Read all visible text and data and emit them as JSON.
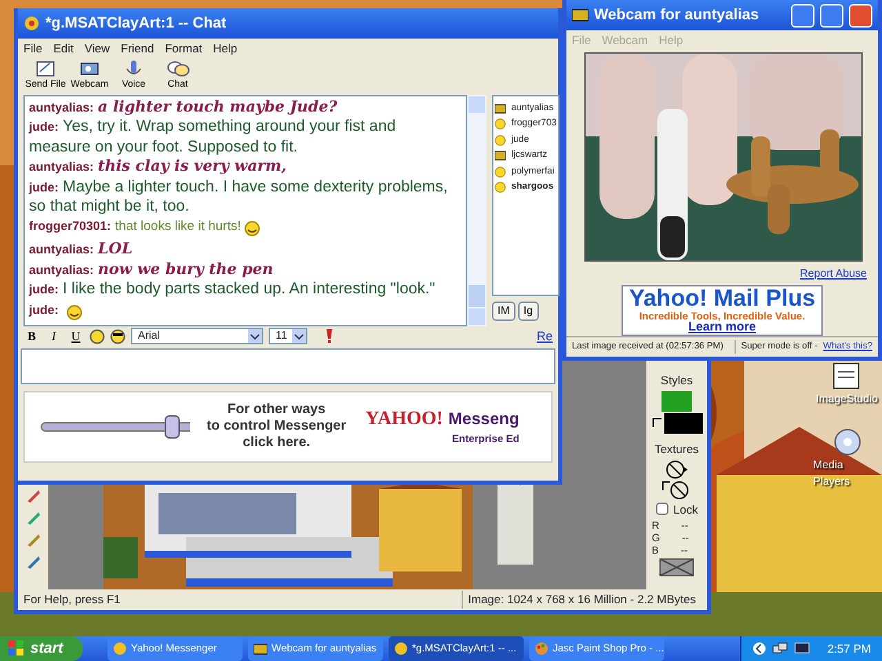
{
  "desktop_icons": [
    {
      "label": "ImageStudio"
    },
    {
      "label": "Media Players"
    }
  ],
  "paint_shop": {
    "styles_label": "Styles",
    "swatches": [
      {
        "color": "#22a022"
      },
      {
        "color": "#000000"
      }
    ],
    "textures_label": "Textures",
    "lock": {
      "label": "Lock",
      "checked": false
    },
    "rgb": [
      {
        "channel": "R",
        "value": "--"
      },
      {
        "channel": "G",
        "value": "--"
      },
      {
        "channel": "B",
        "value": "--"
      }
    ],
    "status_left": "For Help, press F1",
    "status_right": "Image:  1024 x 768 x 16 Million - 2.2 MBytes"
  },
  "chat_window": {
    "title": "*g.MSATClayArt:1 -- Chat",
    "menu": [
      "File",
      "Edit",
      "View",
      "Friend",
      "Format",
      "Help"
    ],
    "toolbar": [
      {
        "label": "Send File",
        "kind": "file"
      },
      {
        "label": "Webcam",
        "kind": "webcam"
      },
      {
        "label": "Voice",
        "kind": "voice"
      },
      {
        "label": "Chat",
        "kind": "chat"
      }
    ],
    "messages": [
      {
        "sender": "auntyalias:",
        "text": "a lighter touch maybe Jude?",
        "kind": "script",
        "color": "#8a1c4e"
      },
      {
        "sender": "jude:",
        "text": "Yes, try it. Wrap something around your fist and measure on your foot. Supposed to fit.",
        "kind": "comic",
        "color": "#1d5a2c"
      },
      {
        "sender": "auntyalias:",
        "text": "this clay is very warm,",
        "kind": "script",
        "color": "#8a1c4e"
      },
      {
        "sender": "jude:",
        "text": "Maybe a lighter touch. I have some dexterity problems, so that might be it, too.",
        "kind": "comic",
        "color": "#1d5a2c"
      },
      {
        "sender": "frogger70301:",
        "text": "that looks like it hurts!",
        "kind": "plain",
        "color": "#5f8a2a",
        "emoticon": true
      },
      {
        "sender": "auntyalias:",
        "text": "LOL",
        "kind": "script",
        "color": "#8a1c4e"
      },
      {
        "sender": "auntyalias:",
        "text": "now we bury the pen",
        "kind": "script",
        "color": "#8a1c4e"
      },
      {
        "sender": "jude:",
        "text": "I like the body parts stacked up. An interesting \"look.\"",
        "kind": "comic",
        "color": "#1d5a2c"
      },
      {
        "sender": "jude:",
        "kind": "comic",
        "emoticon": true
      }
    ],
    "users": [
      {
        "name": "auntyalias",
        "kind": "webcam",
        "bold": false
      },
      {
        "name": "frogger703",
        "kind": "smiley",
        "bold": false
      },
      {
        "name": "jude",
        "kind": "smiley",
        "bold": false
      },
      {
        "name": "ljcswartz",
        "kind": "webcam",
        "bold": false
      },
      {
        "name": "polymerfai",
        "kind": "smiley",
        "bold": false
      },
      {
        "name": "shargoos",
        "kind": "smiley",
        "bold": true
      }
    ],
    "buttons": [
      "IM",
      "Ig"
    ],
    "format_bar": {
      "bold": "B",
      "italic": "I",
      "underline": "U",
      "font": "Arial",
      "size": "11"
    },
    "link": "Re",
    "ad": {
      "lines": [
        "For other ways",
        "to control Messenger",
        "click here."
      ],
      "brand": "YAHOO!",
      "product": "Messeng",
      "edition": "Enterprise Ed"
    }
  },
  "webcam_window": {
    "title": "Webcam for auntyalias",
    "menu": [
      {
        "label": "File",
        "disabled": true
      },
      {
        "label": "Webcam",
        "disabled": true
      },
      {
        "label": "Help",
        "disabled": true
      }
    ],
    "report_link": "Report Abuse",
    "ad": {
      "title": "Yahoo! Mail Plus",
      "tagline": "Incredible Tools, Incredible Value.",
      "link": "Learn more"
    },
    "status": "Last image received at (02:57:36 PM)",
    "super_mode": "Super mode is off -",
    "whats_this": "What's this?"
  },
  "taskbar": {
    "start": "start",
    "tasks": [
      {
        "label": "Yahoo! Messenger",
        "kind": "messenger",
        "selected": false
      },
      {
        "label": "Webcam for auntyalias",
        "kind": "webcam",
        "selected": false
      },
      {
        "label": "*g.MSATClayArt:1 -- ...",
        "kind": "messenger",
        "selected": true
      },
      {
        "label": "Jasc Paint Shop Pro - ...",
        "kind": "paint",
        "selected": false
      }
    ],
    "clock": "2:57 PM"
  }
}
